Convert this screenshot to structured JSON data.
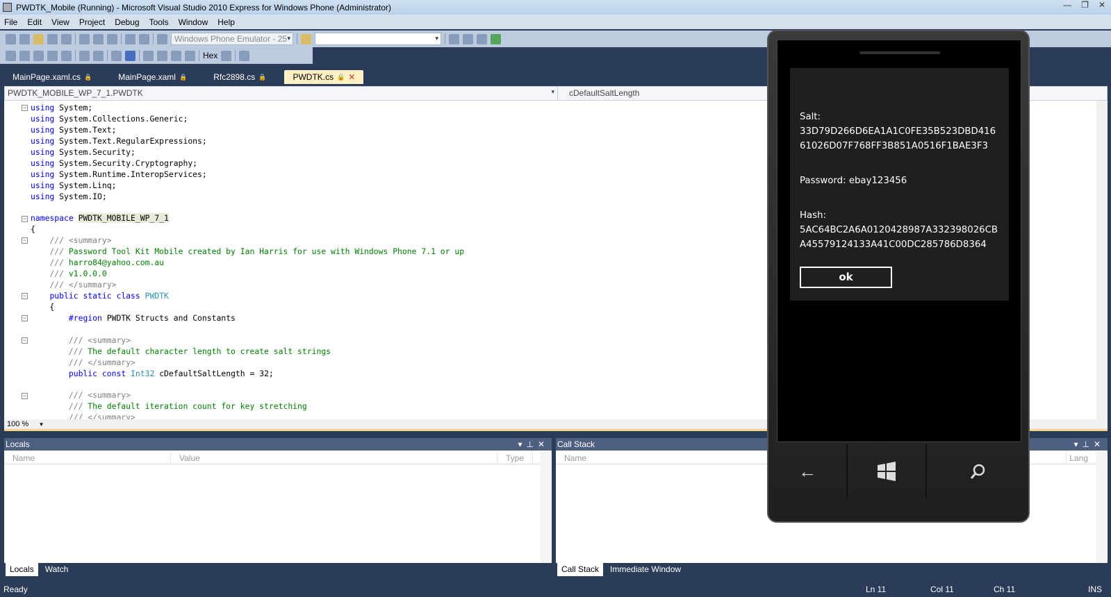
{
  "window": {
    "title": "PWDTK_Mobile (Running) - Microsoft Visual Studio 2010 Express for Windows Phone (Administrator)",
    "controls": [
      "—",
      "❐",
      "✕"
    ]
  },
  "menu": [
    "File",
    "Edit",
    "View",
    "Project",
    "Debug",
    "Tools",
    "Window",
    "Help"
  ],
  "toolbar": {
    "target_device": "Windows Phone Emulator - 25",
    "search_value": "",
    "hex_label": "Hex"
  },
  "tabs": [
    {
      "label": "MainPage.xaml.cs",
      "active": false
    },
    {
      "label": "MainPage.xaml",
      "active": false
    },
    {
      "label": "Rfc2898.cs",
      "active": false
    },
    {
      "label": "PWDTK.cs",
      "active": true
    }
  ],
  "navbar": {
    "type": "PWDTK_MOBILE_WP_7_1.PWDTK",
    "member": "cDefaultSaltLength"
  },
  "code": [
    [
      [
        "using",
        "kw"
      ],
      [
        " System;",
        ""
      ]
    ],
    [
      [
        "using",
        "kw"
      ],
      [
        " System.Collections.Generic;",
        ""
      ]
    ],
    [
      [
        "using",
        "kw"
      ],
      [
        " System.Text;",
        ""
      ]
    ],
    [
      [
        "using",
        "kw"
      ],
      [
        " System.Text.RegularExpressions;",
        ""
      ]
    ],
    [
      [
        "using",
        "kw"
      ],
      [
        " System.Security;",
        ""
      ]
    ],
    [
      [
        "using",
        "kw"
      ],
      [
        " System.Security.Cryptography;",
        ""
      ]
    ],
    [
      [
        "using",
        "kw"
      ],
      [
        " System.Runtime.InteropServices;",
        ""
      ]
    ],
    [
      [
        "using",
        "kw"
      ],
      [
        " System.Linq;",
        ""
      ]
    ],
    [
      [
        "using",
        "kw"
      ],
      [
        " System.IO;",
        ""
      ]
    ],
    [],
    [
      [
        "namespace",
        "kw"
      ],
      [
        " ",
        ""
      ],
      [
        "PWDTK_MOBILE_WP_7_1",
        "hl"
      ]
    ],
    [
      [
        "{",
        ""
      ]
    ],
    [
      [
        "    /// ",
        "doc"
      ],
      [
        "<summary>",
        "doc"
      ]
    ],
    [
      [
        "    /// ",
        "doc"
      ],
      [
        "Password Tool Kit Mobile created by Ian Harris for use with Windows Phone 7.1 or up",
        "cm"
      ]
    ],
    [
      [
        "    /// ",
        "doc"
      ],
      [
        "harro84@yahoo.com.au",
        "cm"
      ]
    ],
    [
      [
        "    /// ",
        "doc"
      ],
      [
        "v1.0.0.0",
        "cm"
      ]
    ],
    [
      [
        "    /// ",
        "doc"
      ],
      [
        "</summary>",
        "doc"
      ]
    ],
    [
      [
        "    ",
        ""
      ],
      [
        "public",
        "kw"
      ],
      [
        " ",
        ""
      ],
      [
        "static",
        "kw"
      ],
      [
        " ",
        ""
      ],
      [
        "class",
        "kw"
      ],
      [
        " ",
        ""
      ],
      [
        "PWDTK",
        "ty"
      ]
    ],
    [
      [
        "    {",
        ""
      ]
    ],
    [
      [
        "        ",
        ""
      ],
      [
        "#region",
        "kw"
      ],
      [
        " PWDTK Structs and Constants",
        ""
      ]
    ],
    [],
    [
      [
        "        /// ",
        "doc"
      ],
      [
        "<summary>",
        "doc"
      ]
    ],
    [
      [
        "        /// ",
        "doc"
      ],
      [
        "The default character length to create salt strings",
        "cm"
      ]
    ],
    [
      [
        "        /// ",
        "doc"
      ],
      [
        "</summary>",
        "doc"
      ]
    ],
    [
      [
        "        ",
        ""
      ],
      [
        "public",
        "kw"
      ],
      [
        " ",
        ""
      ],
      [
        "const",
        "kw"
      ],
      [
        " ",
        ""
      ],
      [
        "Int32",
        "ty"
      ],
      [
        " cDefaultSaltLength = 32;",
        ""
      ]
    ],
    [],
    [
      [
        "        /// ",
        "doc"
      ],
      [
        "<summary>",
        "doc"
      ]
    ],
    [
      [
        "        /// ",
        "doc"
      ],
      [
        "The default iteration count for key stretching",
        "cm"
      ]
    ],
    [
      [
        "        /// ",
        "doc"
      ],
      [
        "</summary>",
        "doc"
      ]
    ]
  ],
  "folds": [
    0,
    10,
    12,
    17,
    19,
    21,
    26
  ],
  "editor": {
    "zoom": "100 %"
  },
  "locals": {
    "title": "Locals",
    "columns": [
      "Name",
      "Value",
      "Type"
    ]
  },
  "callstack": {
    "title": "Call Stack",
    "columns": [
      "Name",
      "Lang"
    ]
  },
  "bottom_tabs_left": [
    "Locals",
    "Watch"
  ],
  "bottom_tabs_right": [
    "Call Stack",
    "Immediate Window"
  ],
  "status": {
    "text": "Ready",
    "ln": "Ln 11",
    "col": "Col 11",
    "ch": "Ch 11",
    "mode": "INS"
  },
  "phone": {
    "salt_label": "Salt:",
    "salt_value": "33D79D266D6EA1A1C0FE35B523DBD41661026D07F768FF3B851A0516F1BAE3F3",
    "password_text": "Password: ebay123456",
    "hash_label": "Hash:",
    "hash_value": "5AC64BC2A6A0120428987A332398026CBA45579124133A41C00DC285786D8364",
    "ok_label": "ok",
    "buttons": [
      "back-icon",
      "windows-start-icon",
      "search-icon"
    ]
  }
}
